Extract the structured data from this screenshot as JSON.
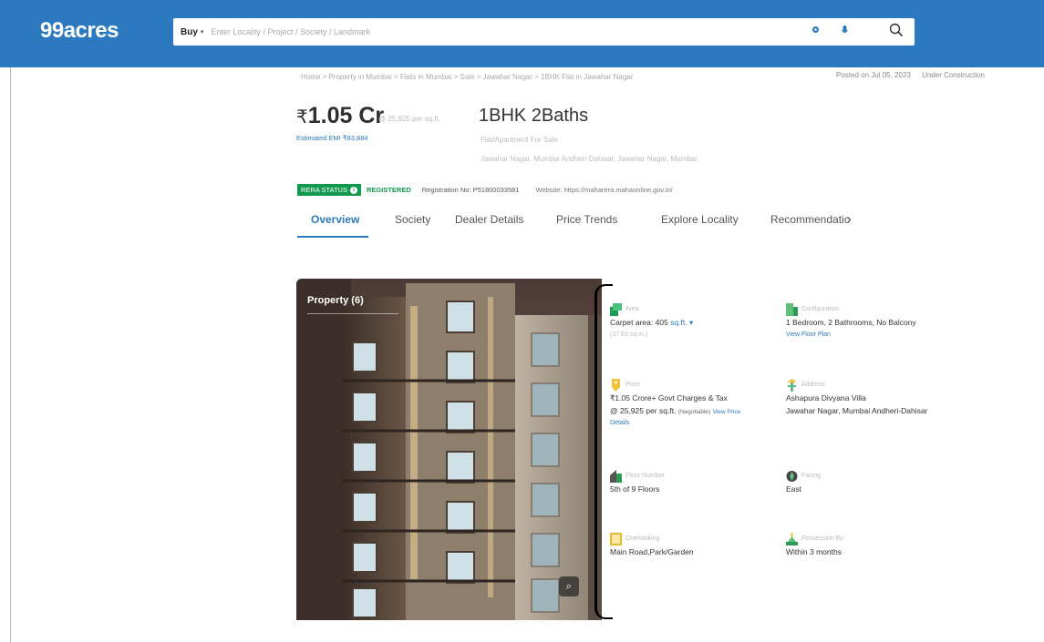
{
  "header": {
    "logo": "99acres",
    "buy_label": "Buy",
    "search_placeholder": "Enter Locality / Project / Society / Landmark"
  },
  "breadcrumb": "Home > Property in Mumbai > Flats in Mumbai > Sale > Jawahar Nagar > 1BHK Flat in Jawahar Nagar",
  "posted": {
    "date": "Posted on Jul 05, 2023",
    "status": "Under Construction"
  },
  "price": {
    "symbol": "₹",
    "amount": "1.05 Cr",
    "per_sqft": "@ 25,925 per sq.ft.",
    "emi": "Estimated EMI ₹83,884"
  },
  "config": {
    "title": "1BHK 2Baths",
    "type": "Flat/Apartment For Sale",
    "address": "Jawahar Nagar, Mumbai Andheri-Dahisar, Jawahar Nagar, Mumbai"
  },
  "rera": {
    "status_label": "RERA STATUS",
    "registered_label": "REGISTERED",
    "registration": "Registration No: P51800033581",
    "website": "Website: https://maharera.mahaonline.gov.in/"
  },
  "tabs": [
    "Overview",
    "Society",
    "Dealer Details",
    "Price Trends",
    "Explore Locality",
    "Recommendatic"
  ],
  "photo": {
    "count_label": "Property (6)"
  },
  "details": {
    "area": {
      "label": "Area",
      "value": "Carpet area: 405",
      "unit": "sq.ft.",
      "sub": "(37.63 sq.m.)"
    },
    "configuration": {
      "label": "Configuration",
      "value": "1 Bedroom, 2 Bathrooms, No Balcony",
      "link": "View Floor Plan"
    },
    "price": {
      "label": "Price",
      "value": "₹1.05 Crore+ Govt Charges & Tax",
      "value2": "@ 25,925 per sq.ft.",
      "negotiable": "(Negotiable)",
      "link": "View Price",
      "link2": "Details"
    },
    "address": {
      "label": "Address",
      "value": "Ashapura Divyana Villa",
      "value2": "Jawahar Nagar, Mumbai Andheri-Dahisar"
    },
    "floor": {
      "label": "Floor Number",
      "value": "5th of 9 Floors"
    },
    "facing": {
      "label": "Facing",
      "value": "East"
    },
    "overlooking": {
      "label": "Overlooking",
      "value": "Main Road,Park/Garden"
    },
    "possession": {
      "label": "Possession By",
      "value": "Within 3 months"
    }
  },
  "colors": {
    "brand": "#2c79bf",
    "rera_green": "#13994f"
  }
}
